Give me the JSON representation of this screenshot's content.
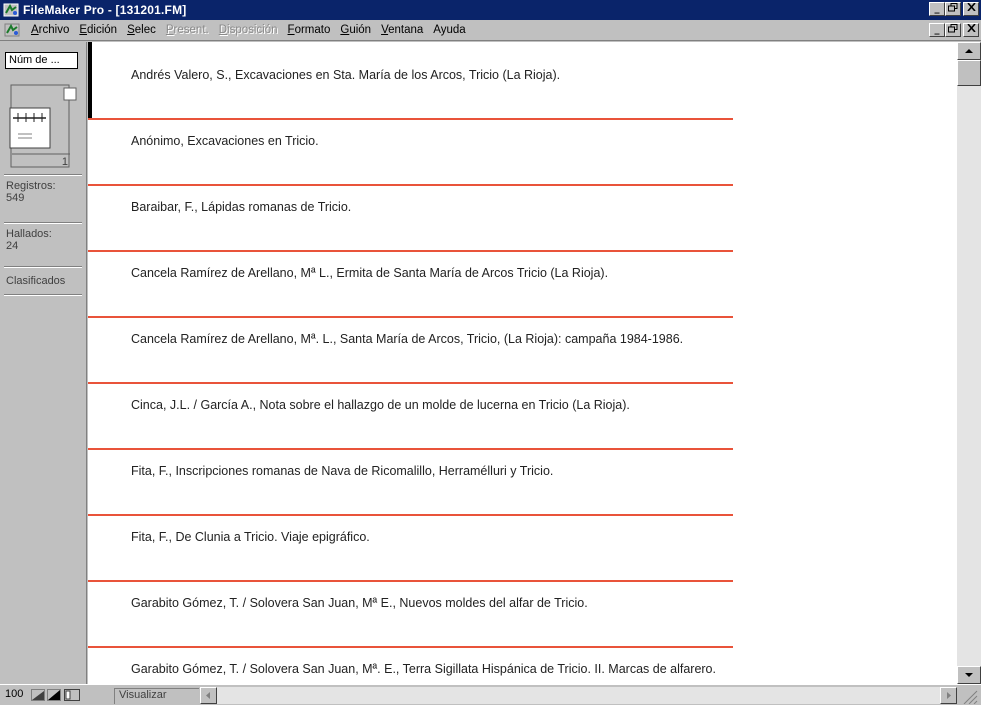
{
  "window": {
    "title": "FileMaker Pro - [131201.FM]",
    "minimize_glyph": "_",
    "restore_glyph": "🗗",
    "close_glyph": "✕"
  },
  "menu": {
    "items": [
      {
        "label": "Archivo",
        "mnemonic": "A",
        "rest": "rchivo",
        "enabled": true
      },
      {
        "label": "Edición",
        "mnemonic": "E",
        "rest": "dición",
        "enabled": true
      },
      {
        "label": "Selec",
        "mnemonic": "S",
        "rest": "elec",
        "enabled": true
      },
      {
        "label": "Present.",
        "mnemonic": "P",
        "rest": "resent.",
        "enabled": false
      },
      {
        "label": "Disposición",
        "mnemonic": "D",
        "rest": "isposición",
        "enabled": false
      },
      {
        "label": "Formato",
        "mnemonic": "F",
        "rest": "ormato",
        "enabled": true
      },
      {
        "label": "Guión",
        "mnemonic": "G",
        "rest": "uión",
        "enabled": true
      },
      {
        "label": "Ventana",
        "mnemonic": "V",
        "rest": "entana",
        "enabled": true
      },
      {
        "label": "Ayuda",
        "mnemonic": "",
        "rest": "Ayuda",
        "enabled": true
      }
    ]
  },
  "status": {
    "layout_popup": "Núm de ...",
    "record_number": "1",
    "records_label": "Registros:",
    "records_value": "549",
    "found_label": "Hallados:",
    "found_value": "24",
    "sorted_label": "Clasificados"
  },
  "records": [
    "Andrés Valero, S., Excavaciones en Sta. María de los Arcos, Tricio (La Rioja).",
    "Anónimo, Excavaciones en Tricio.",
    "Baraibar, F., Lápidas romanas de Tricio.",
    "Cancela Ramírez de Arellano, Mª L., Ermita de Santa María de Arcos Tricio (La Rioja).",
    "Cancela Ramírez de Arellano, Mª. L., Santa María de Arcos, Tricio, (La Rioja): campaña 1984-1986.",
    "Cinca, J.L. / García A., Nota sobre el hallazgo de un molde de lucerna en Tricio (La Rioja).",
    "Fita, F., Inscripciones romanas de Nava de Ricomalillo, Herramélluri y Tricio.",
    "Fita, F., De Clunia a Tricio. Viaje epigráfico.",
    "Garabito Gómez, T. / Solovera San Juan, Mª E., Nuevos moldes del alfar de Tricio.",
    "Garabito Gómez, T. / Solovera San Juan, Mª. E., Terra Sigillata Hispánica de Tricio. II. Marcas de alfarero."
  ],
  "bottom": {
    "zoom": "100",
    "mode": "Visualizar"
  },
  "colors": {
    "separator": "#e9533a",
    "titlebar": "#0a246a"
  }
}
